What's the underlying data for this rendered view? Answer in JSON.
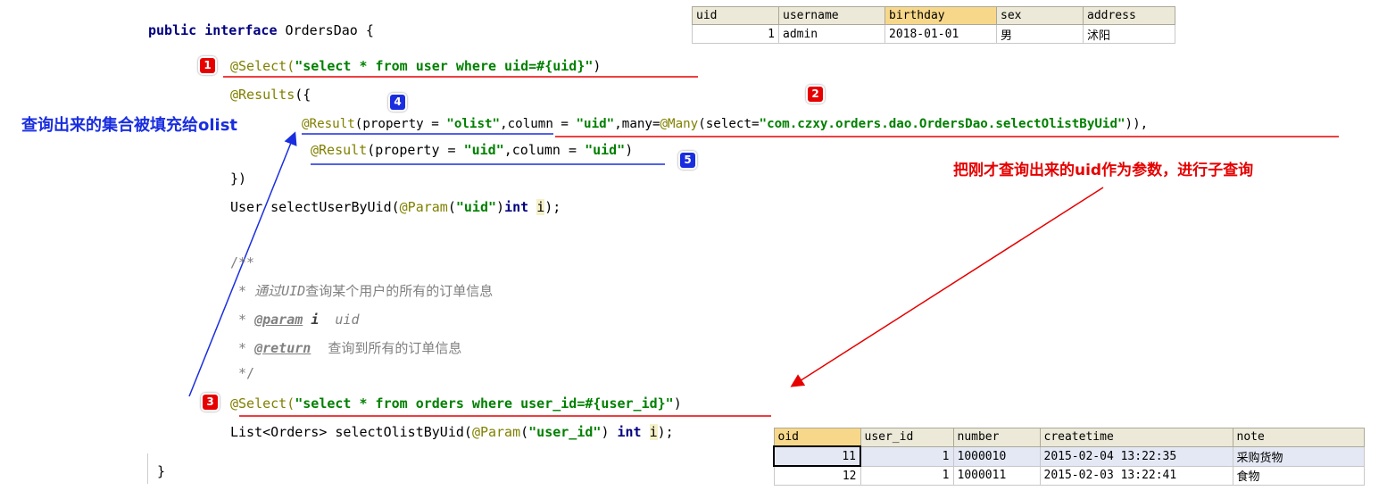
{
  "code": {
    "l1": {
      "kw": "public interface",
      "name": " OrdersDao {"
    },
    "l2": {
      "ann": "@Select(",
      "str": "\"select * from user where uid=#{uid}\"",
      "end": ")"
    },
    "l3": {
      "ann": "@Results",
      "end": "({"
    },
    "l4": {
      "ann": "@Result",
      "a": "(property = ",
      "s1": "\"olist\"",
      "b": ",column = ",
      "s2": "\"uid\"",
      "c": ",many=",
      "ann2": "@Many",
      "d": "(select=",
      "s3": "\"com.czxy.orders.dao.OrdersDao.selectOlistByUid\"",
      "e": ")),"
    },
    "l5": {
      "ann": "@Result",
      "a": "(property = ",
      "s1": "\"uid\"",
      "b": ",column = ",
      "s2": "\"uid\"",
      "e": ")"
    },
    "l6": "})",
    "l7": {
      "a": "User selectUserByUid(",
      "ann": "@Param",
      "b": "(",
      "s": "\"uid\"",
      "c": ")",
      "kw": "int",
      "d": " ",
      "i": "i",
      "e": ");"
    },
    "c1": "/**",
    "c2": {
      "star": " * ",
      "it": "通过UID",
      "txt": "查询某个用户的所有的订单信息"
    },
    "c3": {
      "star": " * ",
      "tag": "@param",
      "sp": " ",
      "p": "i",
      "rest": "  uid"
    },
    "c4": {
      "star": " * ",
      "tag": "@return",
      "rest": "    查询到所有的订单信息"
    },
    "c5": " */",
    "l8": {
      "ann": "@Select(",
      "str": "\"select * from orders where user_id=#{user_id}\"",
      "end": ")"
    },
    "l9": {
      "a": "List<Orders> selectOlistByUid(",
      "ann": "@Param",
      "b": "(",
      "s": "\"user_id\"",
      "c": ") ",
      "kw": "int",
      "d": " ",
      "i": "i",
      "e": ");"
    },
    "l10": "}"
  },
  "badges": [
    "1",
    "2",
    "3",
    "4",
    "5"
  ],
  "notes": {
    "blue": "查询出来的集合被填充给olist",
    "red": "把刚才查询出来的uid作为参数，进行子查询"
  },
  "user_table": {
    "headers": [
      "uid",
      "username",
      "birthday",
      "sex",
      "address"
    ],
    "row": [
      "1",
      "admin",
      "2018-01-01",
      "男",
      "沭阳"
    ]
  },
  "orders_table": {
    "headers": [
      "oid",
      "user_id",
      "number",
      "createtime",
      "note"
    ],
    "rows": [
      [
        "11",
        "1",
        "1000010",
        "2015-02-04 13:22:35",
        "采购货物"
      ],
      [
        "12",
        "1",
        "1000011",
        "2015-02-03 13:22:41",
        "食物"
      ]
    ]
  },
  "colors": {
    "red": "#e60000",
    "blue": "#1a2ee0",
    "annotation": "#808000",
    "string": "#008000",
    "keyword": "#000080"
  }
}
